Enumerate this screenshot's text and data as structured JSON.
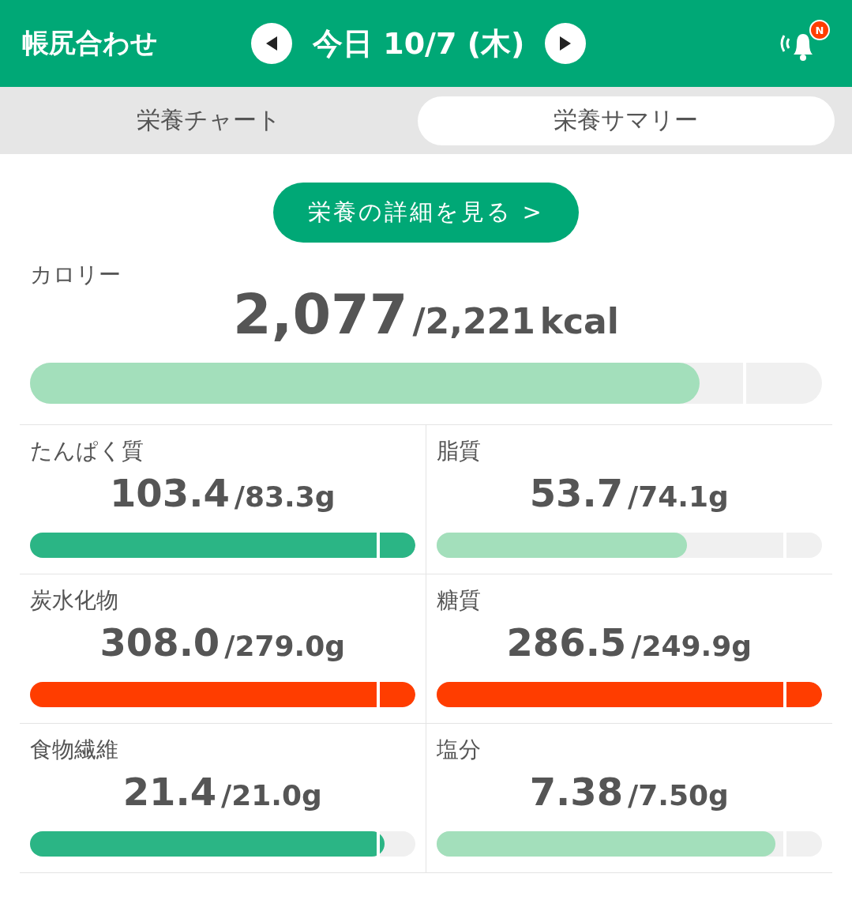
{
  "header": {
    "title": "帳尻合わせ",
    "date": "今日 10/7 (木)",
    "badge": "N"
  },
  "tabs": [
    {
      "label": "栄養チャート",
      "selected": false
    },
    {
      "label": "栄養サマリー",
      "selected": true
    }
  ],
  "details_button": "栄養の詳細を見る >",
  "calorie": {
    "label": "カロリー",
    "value": "2,077",
    "target": "/2,221",
    "unit": "kcal",
    "level": 0.845,
    "color": "#a3dfbb"
  },
  "nutrients": [
    {
      "label": "たんぱく質",
      "value": "103.4",
      "target": "/83.3g",
      "level": 1,
      "color": "#2bb585"
    },
    {
      "label": "脂質",
      "value": "53.7",
      "target": "/74.1g",
      "level": 0.65,
      "color": "#a3dfbb"
    },
    {
      "label": "炭水化物",
      "value": "308.0",
      "target": "/279.0g",
      "level": 1,
      "color": "#ff3d00"
    },
    {
      "label": "糖質",
      "value": "286.5",
      "target": "/249.9g",
      "level": 1,
      "color": "#ff3d00"
    },
    {
      "label": "食物繊維",
      "value": "21.4",
      "target": "/21.0g",
      "level": 0.92,
      "color": "#2bb585"
    },
    {
      "label": "塩分",
      "value": "7.38",
      "target": "/7.50g",
      "level": 0.88,
      "color": "#a3dfbb"
    }
  ]
}
